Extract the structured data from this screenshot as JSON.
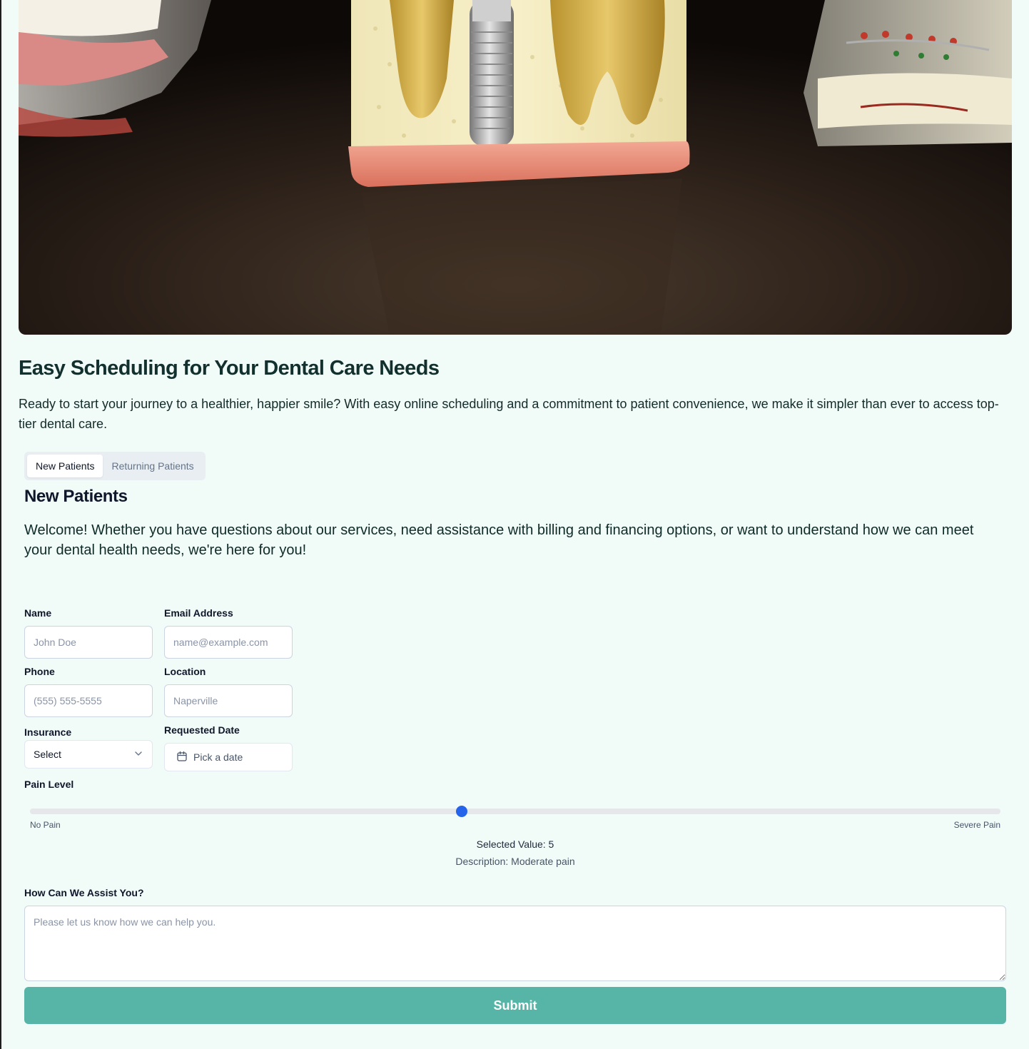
{
  "hero": {
    "image_description": "dental-implant-model-photo"
  },
  "page": {
    "title": "Easy Scheduling for Your Dental Care Needs",
    "intro": "Ready to start your journey to a healthier, happier smile? With easy online scheduling and a commitment to patient convenience, we make it simpler than ever to access top-tier dental care."
  },
  "tabs": [
    {
      "label": "New Patients",
      "active": true
    },
    {
      "label": "Returning Patients",
      "active": false
    }
  ],
  "section": {
    "title": "New Patients",
    "welcome": "Welcome! Whether you have questions about our services, need assistance with billing and financing options, or want to understand how we can meet your dental health needs, we're here for you!"
  },
  "form": {
    "name": {
      "label": "Name",
      "placeholder": "John Doe",
      "value": ""
    },
    "email": {
      "label": "Email Address",
      "placeholder": "name@example.com",
      "value": ""
    },
    "phone": {
      "label": "Phone",
      "placeholder": "(555) 555-5555",
      "value": ""
    },
    "location": {
      "label": "Location",
      "placeholder": "Naperville",
      "value": ""
    },
    "insurance": {
      "label": "Insurance",
      "selected": "Select"
    },
    "date": {
      "label": "Requested Date",
      "button_label": "Pick a date"
    },
    "pain": {
      "label": "Pain Level",
      "min_label": "No Pain",
      "max_label": "Severe Pain",
      "value": 5,
      "selected_text": "Selected Value: 5",
      "description_text": "Description: Moderate pain"
    },
    "assist": {
      "label": "How Can We Assist You?",
      "placeholder": "Please let us know how we can help you.",
      "value": ""
    },
    "submit_label": "Submit"
  },
  "colors": {
    "background": "#f1fbf8",
    "accent": "#56b5a6",
    "slider_thumb": "#2563eb"
  }
}
